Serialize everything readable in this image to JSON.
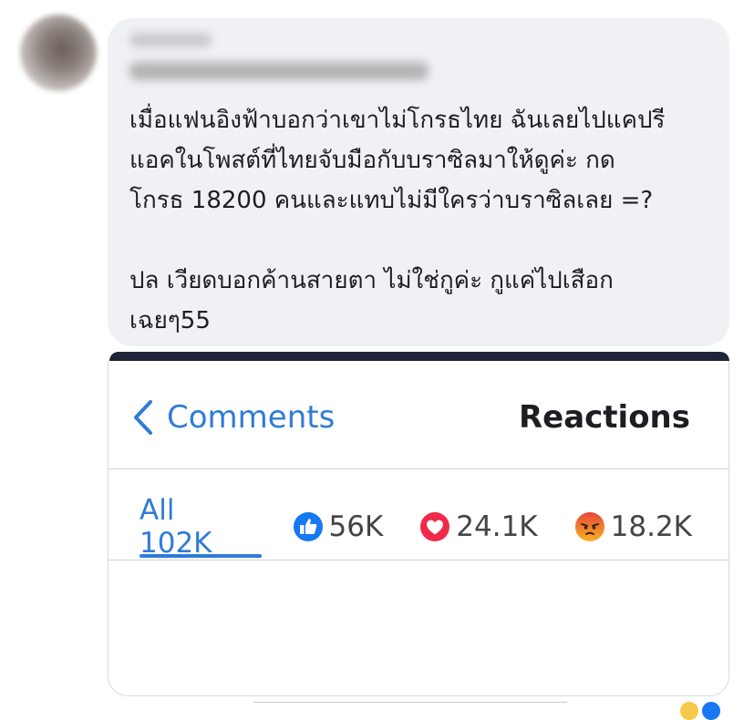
{
  "post": {
    "lines_para1": [
      "เมื่อแฟนอิงฟ้าบอกว่าเขาไม่โกรธไทย ฉันเลยไปแคปรี",
      "แอคในโพสต์ที่ไทยจับมือกับบราซิลมาให้ดูค่ะ กด",
      "โกรธ 18200 คนและแทบไม่มีใครว่าบราซิลเลย =?"
    ],
    "lines_para2": [
      "ปล เวียดบอกค้านสายตา ไม่ใช่กูค่ะ กูแค่ไปเสือก",
      "เฉยๆ55"
    ]
  },
  "screenshot": {
    "back_label": "Comments",
    "title": "Reactions",
    "tabs": {
      "all": "All 102K",
      "like": "56K",
      "love": "24.1K",
      "angry": "18.2K"
    }
  },
  "colors": {
    "accent": "#2f7bd8",
    "like": "#1877f2",
    "love": "#f02849",
    "angry": "#f07b22"
  },
  "icons": [
    "chevron-left-icon",
    "like-icon",
    "love-icon",
    "angry-icon"
  ]
}
